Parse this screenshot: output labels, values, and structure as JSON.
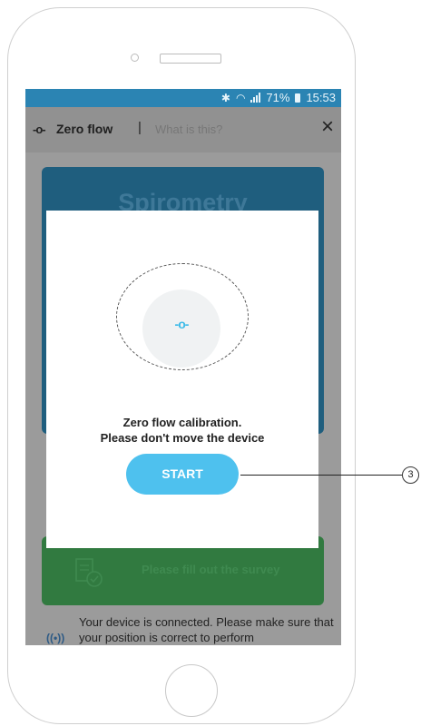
{
  "status_bar": {
    "battery": "71%",
    "time": "15:53",
    "icons": [
      "bluetooth-icon",
      "wifi-icon",
      "signal-icon",
      "battery-icon"
    ],
    "color": "#2b84b3"
  },
  "app_bar": {
    "title": "Zero flow",
    "separator": "|",
    "help_link": "What is this?",
    "close_icon": "×"
  },
  "background": {
    "card_title": "Spirometry",
    "survey_label": "Please fill out the survey",
    "connected_text": "Your device is connected. Please make sure that your position is correct to perform"
  },
  "modal": {
    "icon": "-o-",
    "message_line1": "Zero flow calibration.",
    "message_line2": "Please don't move the device",
    "start_button": "START"
  },
  "callout": {
    "number": "3"
  },
  "colors": {
    "accent": "#4ec1ee",
    "status_bar": "#2b84b3",
    "survey": "#317a40",
    "card": "#1f5e7e"
  }
}
